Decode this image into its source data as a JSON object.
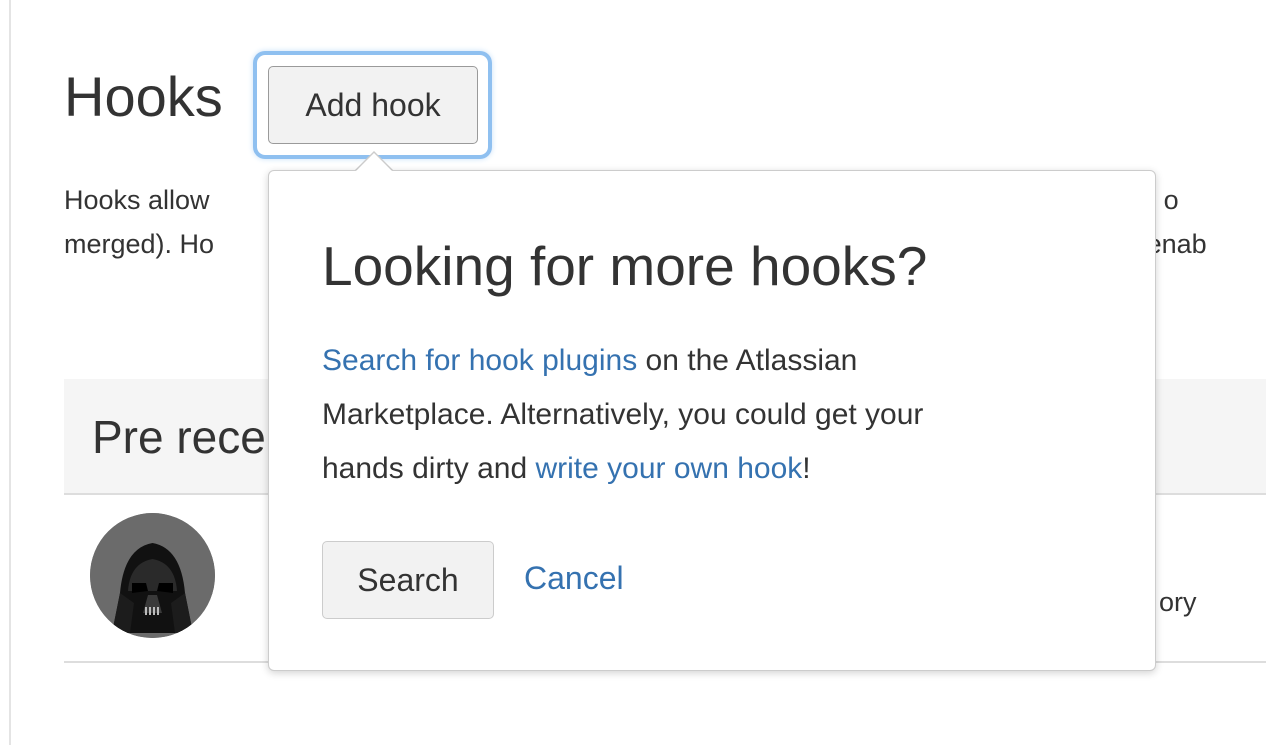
{
  "header": {
    "title": "Hooks",
    "add_hook_label": "Add hook"
  },
  "description": {
    "line1_start": "Hooks allow",
    "line1_end": "sitory o",
    "line2_start": "merged). Ho",
    "line2_end": "e enab"
  },
  "section": {
    "title": "Pre rece"
  },
  "hook_row": {
    "trailing_text": "ory"
  },
  "dialog": {
    "title": "Looking for more hooks?",
    "search_link": "Search for hook plugins",
    "text_after_search_link": " on the Atlassian",
    "line2": "Marketplace. Alternatively, you could get your",
    "line3_start": "hands dirty and ",
    "write_link": "write your own hook",
    "line3_end": "!",
    "search_button": "Search",
    "cancel_link": "Cancel"
  },
  "colors": {
    "link": "#3572b0",
    "focus_ring": "#8fc0f0",
    "section_background": "#f5f5f5"
  }
}
